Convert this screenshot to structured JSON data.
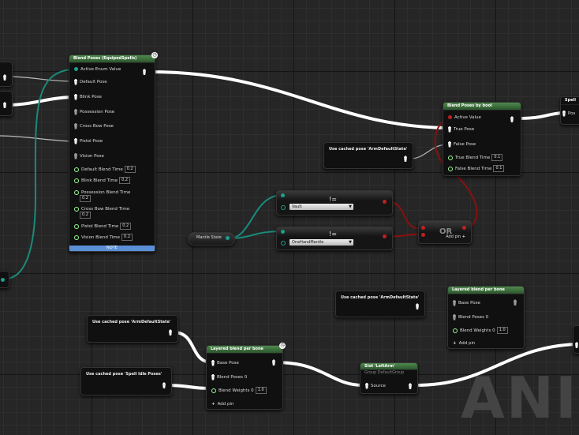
{
  "watermark": "ANIM",
  "blend_poses_enum": {
    "title": "Blend Poses (EquipedSpells)",
    "active_enum_label": "Active Enum Value",
    "pose_pins": [
      "Default Pose",
      "Blink Pose",
      "Possession Pose",
      "Cross Bow Pose",
      "Pistol Pose",
      "Vision Pose"
    ],
    "blend_times": [
      {
        "label": "Default Blend Time",
        "value": "0.2"
      },
      {
        "label": "Blink Blend Time",
        "value": "0.2"
      },
      {
        "label": "Possession Blend Time",
        "value": "0.2"
      },
      {
        "label": "Cross Bow Blend Time",
        "value": "0.2"
      },
      {
        "label": "Pistol Blend Time",
        "value": "0.2"
      },
      {
        "label": "Vision Blend Time",
        "value": "0.2"
      }
    ],
    "note_label": "NOTE"
  },
  "blend_poses_bool": {
    "title": "Blend Poses by bool",
    "active_value": "Active Value",
    "true_pose": "True Pose",
    "false_pose": "False Pose",
    "true_blend_time": {
      "label": "True Blend Time",
      "value": "0.1"
    },
    "false_blend_time": {
      "label": "False Blend Time",
      "value": "0.1"
    }
  },
  "spell_node": {
    "title": "Spell",
    "pin": "Pos"
  },
  "cached_pose_arm_1": "Use cached pose 'ArmDefaultState'",
  "cached_pose_arm_2": "Use cached pose 'ArmDefaultState'",
  "cached_pose_arm_3": "Use cached pose 'ArmDefaultState'",
  "cached_pose_spell_idle": "Use cached pose 'Spell Idle Poses'",
  "compare_vault": {
    "op": "!=",
    "value": "Vault"
  },
  "compare_mantle": {
    "op": "!=",
    "value": "OneHandMantle"
  },
  "mantle_state": "Mantle State",
  "or_node": {
    "title": "OR",
    "add_pin": "Add pin"
  },
  "layered_top": {
    "title": "Layered blend per bone",
    "base_pose": "Base Pose",
    "blend_poses": "Blend Poses 0",
    "blend_weights": {
      "label": "Blend Weights 0",
      "value": "1.0"
    },
    "add_pin": "Add pin"
  },
  "layered_bottom": {
    "title": "Layered blend per bone",
    "base_pose": "Base Pose",
    "blend_poses": "Blend Poses 0",
    "blend_weights": {
      "label": "Blend Weights 0",
      "value": "1.0"
    },
    "add_pin": "Add pin"
  },
  "slot_node": {
    "title": "Slot 'LeftArm'",
    "subtitle": "Group DefaultGroup",
    "source": "Source"
  },
  "colors": {
    "exec_wire": "#ffffff",
    "enum_wire": "#1a8a7a",
    "bool_wire": "#8a1010",
    "header_green": "#3d6e3d",
    "note_blue": "#5a8fd6"
  }
}
